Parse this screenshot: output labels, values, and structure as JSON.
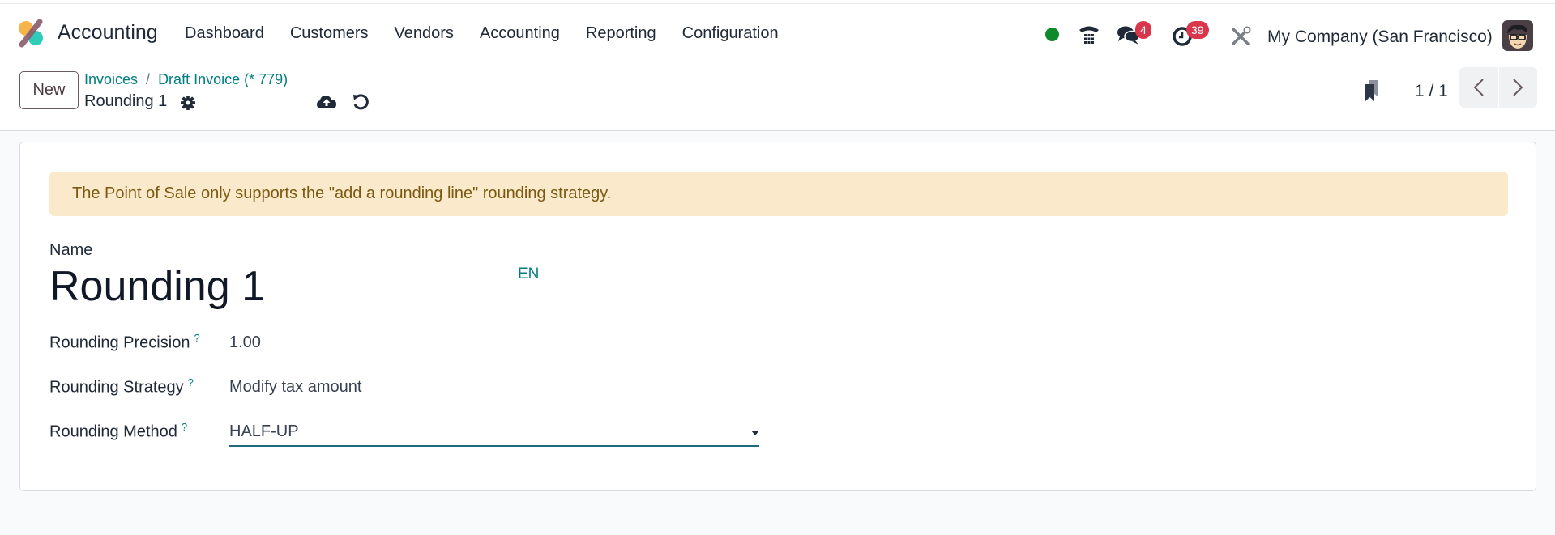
{
  "navbar": {
    "app_name": "Accounting",
    "menu": [
      "Dashboard",
      "Customers",
      "Vendors",
      "Accounting",
      "Reporting",
      "Configuration"
    ],
    "presence_status": "online",
    "messages_badge": "4",
    "activities_badge": "39",
    "company": "My Company (San Francisco)",
    "icons": [
      "app-logo",
      "phone-icon",
      "chat-icon",
      "clock-icon",
      "tools-icon",
      "avatar"
    ]
  },
  "control_panel": {
    "new_label": "New",
    "breadcrumb": [
      "Invoices",
      "Draft Invoice (* 779)"
    ],
    "breadcrumb_separator": "/",
    "record_title": "Rounding 1",
    "pager": "1 / 1"
  },
  "form": {
    "alert": "The Point of Sale only supports the \"add a rounding line\" rounding strategy.",
    "name_label": "Name",
    "name_value": "Rounding 1",
    "lang_label": "EN",
    "help_mark": "?",
    "fields": [
      {
        "label": "Rounding Precision",
        "value": "1.00"
      },
      {
        "label": "Rounding Strategy",
        "value": "Modify tax amount"
      },
      {
        "label": "Rounding Method",
        "value": "HALF-UP"
      }
    ]
  },
  "colors": {
    "accent": "#017e84",
    "badge": "#d9364b",
    "presence": "#0f8a2a",
    "alert_bg": "#fbe9cb",
    "alert_text": "#7a5a10"
  }
}
